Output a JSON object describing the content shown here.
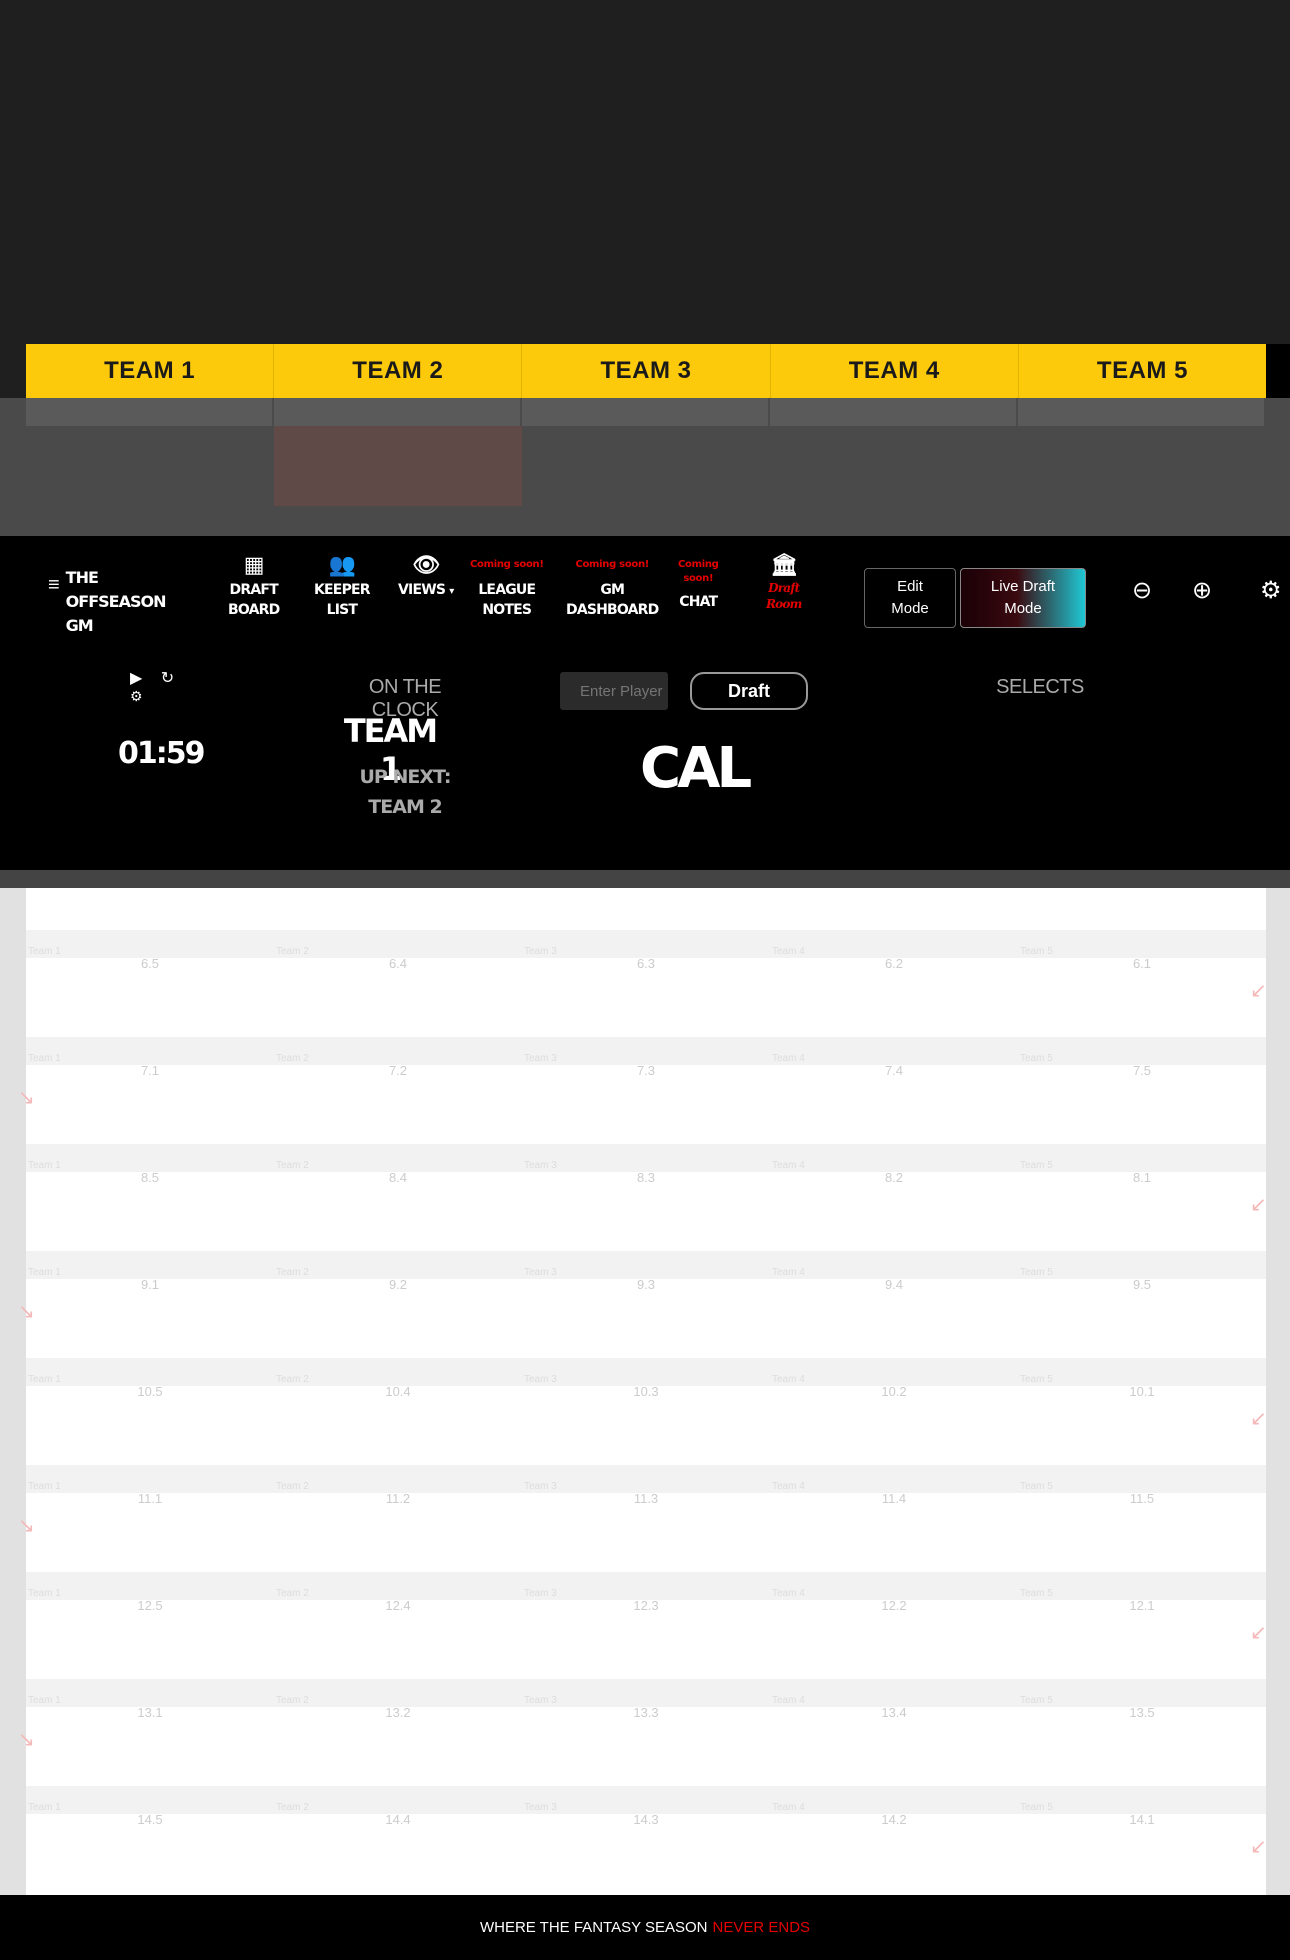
{
  "teams": [
    "TEAM 1",
    "TEAM 2",
    "TEAM 3",
    "TEAM 4",
    "TEAM 5"
  ],
  "brand": {
    "line1": "THE",
    "line2": "OFFSEASON",
    "line3": "GM"
  },
  "nav": {
    "draft_board": {
      "l1": "DRAFT",
      "l2": "BOARD"
    },
    "keeper_list": {
      "l1": "KEEPER",
      "l2": "LIST"
    },
    "views": "VIEWS",
    "league_notes": {
      "tag": "Coming soon!",
      "l1": "LEAGUE",
      "l2": "NOTES"
    },
    "gm_dashboard": {
      "tag": "Coming soon!",
      "l1": "GM",
      "l2": "DASHBOARD"
    },
    "chat": {
      "tag1": "Coming",
      "tag2": "soon!",
      "l1": "CHAT"
    },
    "draft_room": {
      "l1": "Draft",
      "l2": "Room"
    }
  },
  "buttons": {
    "edit_l1": "Edit",
    "edit_l2": "Mode",
    "live_l1": "Live Draft",
    "live_l2": "Mode",
    "draft": "Draft"
  },
  "clock": {
    "timer": "01:59",
    "on_the_clock": "ON THE CLOCK",
    "current_team": "TEAM 1",
    "up_next_label": "UP NEXT:",
    "up_next_team": "TEAM 2",
    "player_placeholder": "Enter Player",
    "player_value": "CAL",
    "selects": "SELECTS"
  },
  "grid": {
    "team_labels": [
      "Team 1",
      "Team 2",
      "Team 3",
      "Team 4",
      "Team 5"
    ],
    "rounds": [
      [
        "6.5",
        "6.4",
        "6.3",
        "6.2",
        "6.1"
      ],
      [
        "7.1",
        "7.2",
        "7.3",
        "7.4",
        "7.5"
      ],
      [
        "8.5",
        "8.4",
        "8.3",
        "8.2",
        "8.1"
      ],
      [
        "9.1",
        "9.2",
        "9.3",
        "9.4",
        "9.5"
      ],
      [
        "10.5",
        "10.4",
        "10.3",
        "10.2",
        "10.1"
      ],
      [
        "11.1",
        "11.2",
        "11.3",
        "11.4",
        "11.5"
      ],
      [
        "12.5",
        "12.4",
        "12.3",
        "12.2",
        "12.1"
      ],
      [
        "13.1",
        "13.2",
        "13.3",
        "13.4",
        "13.5"
      ],
      [
        "14.5",
        "14.4",
        "14.3",
        "14.2",
        "14.1"
      ]
    ]
  },
  "footer": {
    "main": "WHERE THE FANTASY SEASON",
    "highlight": "NEVER ENDS"
  },
  "colors": {
    "accent_yellow": "#fcca0a",
    "accent_red": "#e50000",
    "teal": "#1fc8d4"
  }
}
